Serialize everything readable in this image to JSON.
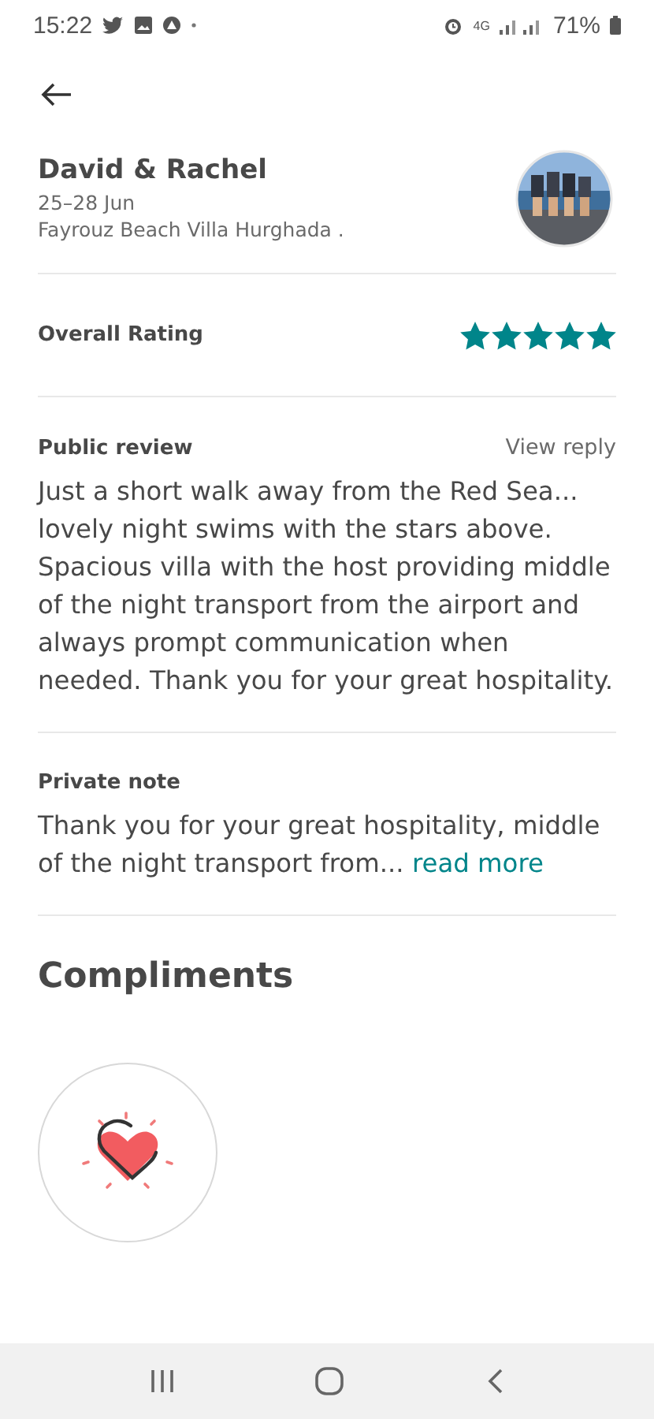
{
  "status_bar": {
    "time": "15:22",
    "network": "4G",
    "battery": "71%"
  },
  "guest": {
    "name": "David & Rachel",
    "dates": "25–28 Jun",
    "listing": "Fayrouz Beach Villa Hurghada ."
  },
  "rating": {
    "label": "Overall Rating",
    "stars": 5
  },
  "public_review": {
    "title": "Public review",
    "action": "View reply",
    "text": "Just a short walk away from the Red Sea... lovely night swims with the stars above. Spacious villa with the host providing middle of the night transport from the airport and always prompt communication when needed. Thank you for your great hospitality."
  },
  "private_note": {
    "title": "Private note",
    "text": "Thank you for your great hospitality, middle of the night transport from...",
    "link": "read more"
  },
  "compliments": {
    "title": "Compliments"
  }
}
